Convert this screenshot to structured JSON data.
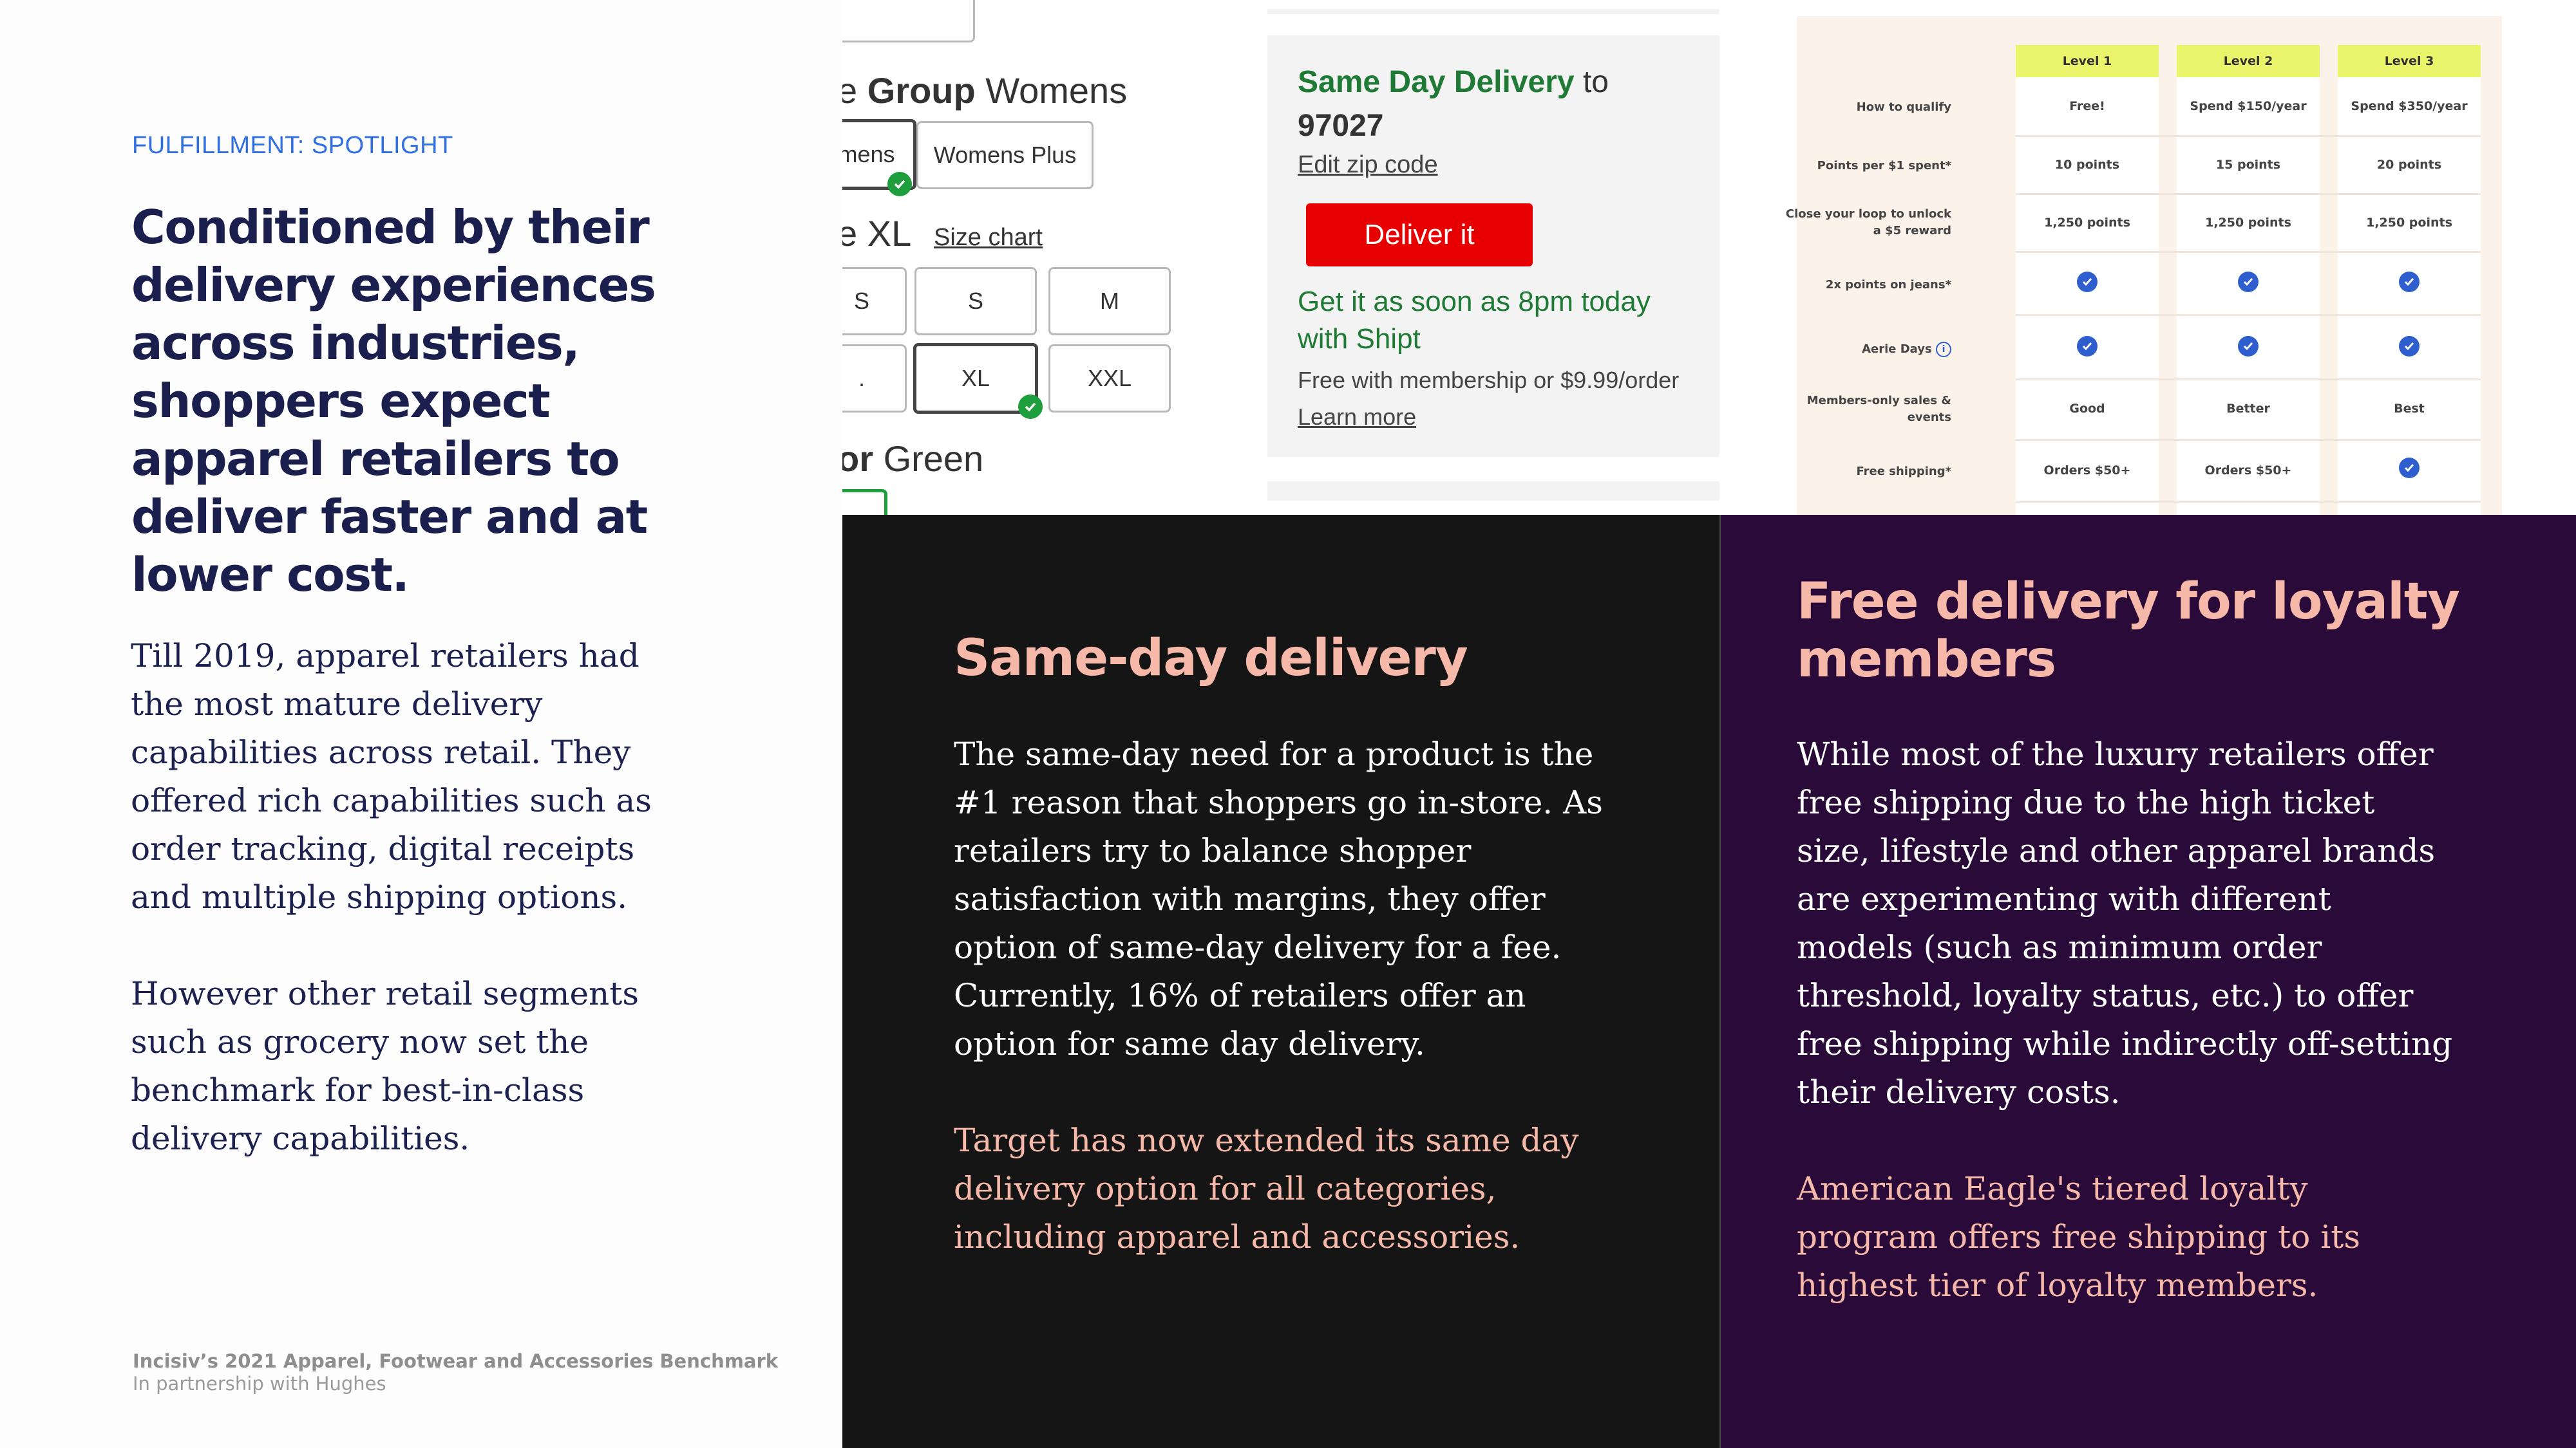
{
  "left": {
    "eyebrow": "FULFILLMENT: SPOTLIGHT",
    "headline": "Conditioned by their delivery experiences across industries, shoppers expect apparel retailers to deliver faster and at lower cost.",
    "paragraph1": "Till 2019, apparel retailers had the most mature delivery capabilities across retail. They offered rich capabilities such as order tracking, digital receipts and multiple shipping options.",
    "paragraph2": "However other retail segments such as grocery now set the benchmark for best-in-class delivery capabilities.",
    "footer_title": "Incisiv’s 2021 Apparel, Footwear and Accessories Benchmark",
    "footer_sub": "In partnership with Hughes"
  },
  "product": {
    "group_prefix": "e",
    "group_bold": "Group",
    "group_value": "Womens",
    "group_options": [
      "mens",
      "Womens Plus"
    ],
    "size_prefix": "e",
    "size_value": "XL",
    "size_chart": "Size chart",
    "sizes_row1": [
      "S",
      "S",
      "M"
    ],
    "sizes_row2": [
      ".",
      "XL",
      "XXL"
    ],
    "color_prefix": "or",
    "color_value": "Green"
  },
  "delivery": {
    "title_bold": "Same Day Delivery",
    "title_rest": " to",
    "zip": "97027",
    "edit_zip": "Edit zip code",
    "button": "Deliver it",
    "eta_line1": "Get it as soon as 8pm today",
    "eta_line2": "with Shipt",
    "price_note": "Free with membership or $9.99/order",
    "learn_more": "Learn more"
  },
  "loyalty_table": {
    "levels": [
      "Level 1",
      "Level 2",
      "Level 3"
    ],
    "rows": [
      {
        "label": "How to qualify",
        "values": [
          "Free!",
          "Spend $150/year",
          "Spend $350/year"
        ]
      },
      {
        "label": "Points per $1 spent*",
        "values": [
          "10 points",
          "15 points",
          "20 points"
        ]
      },
      {
        "label": "Close your loop to unlock a $5 reward",
        "values": [
          "1,250 points",
          "1,250 points",
          "1,250 points"
        ]
      },
      {
        "label": "2x points on jeans*",
        "values": [
          "check",
          "check",
          "check"
        ]
      },
      {
        "label": "Aerie Days",
        "values": [
          "check",
          "check",
          "check"
        ]
      },
      {
        "label": "Members-only sales & events",
        "values": [
          "Good",
          "Better",
          "Best"
        ]
      },
      {
        "label": "Free shipping*",
        "values": [
          "Orders $50+",
          "Orders $50+",
          "check"
        ]
      }
    ]
  },
  "sameday": {
    "title": "Same-day delivery",
    "body": "The same-day need for a product is the #1 reason that shoppers go in-store. As retailers try to balance shopper satisfaction with margins, they offer option of same-day delivery for a fee. Currently, 16% of retailers offer an option for same day delivery.",
    "accent": "Target has now extended its same day delivery option for all categories, including apparel and accessories."
  },
  "loyalty": {
    "title": "Free delivery for loyalty members",
    "body": "While most of the luxury retailers offer free shipping due to the high ticket size, lifestyle and other apparel brands are experimenting with different models (such as minimum order threshold, loyalty status, etc.) to offer free shipping while indirectly off-setting their delivery costs.",
    "accent": "American Eagle's tiered loyalty program offers free shipping to its highest tier of loyalty members."
  },
  "colors": {
    "eyebrow": "#2f6fe0",
    "headline": "#1a1f4e",
    "dark_panel": "#151515",
    "purple_panel": "#2a0a38",
    "accent_pink": "#f6b8a8",
    "deliver_button": "#e60000"
  }
}
